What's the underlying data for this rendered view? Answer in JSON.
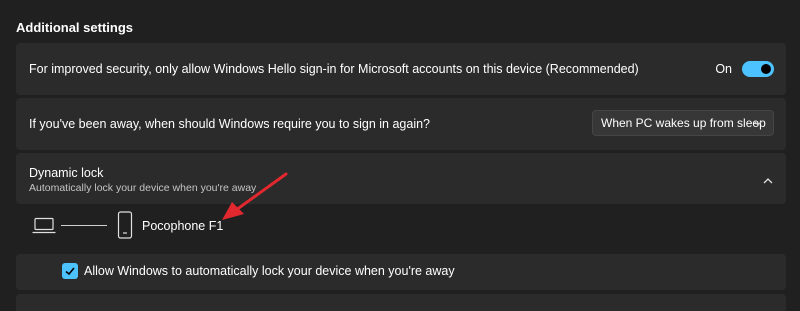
{
  "section": {
    "title": "Additional settings"
  },
  "hello_signin": {
    "label": "For improved security, only allow Windows Hello sign-in for Microsoft accounts on this device (Recommended)",
    "toggle_state": "On",
    "toggle_on": true
  },
  "require_signin": {
    "label": "If you've been away, when should Windows require you to sign in again?",
    "selected_option": "When PC wakes up from sleep"
  },
  "dynamic_lock": {
    "title": "Dynamic lock",
    "description": "Automatically lock your device when you're away",
    "expanded": true,
    "paired_device": "Pocophone F1",
    "checkbox_label": "Allow Windows to automatically lock your device when you're away",
    "checkbox_checked": true
  },
  "colors": {
    "accent": "#4cc2ff",
    "background": "#202020",
    "card": "#2b2b2b",
    "arrow": "#e0282e"
  },
  "icons": {
    "toggle": "toggle-switch",
    "dropdown": "chevron-down-icon",
    "expander": "chevron-up-icon",
    "laptop": "laptop-icon",
    "phone": "phone-icon",
    "checkbox": "checkmark-icon",
    "annotation": "red-arrow-icon"
  }
}
